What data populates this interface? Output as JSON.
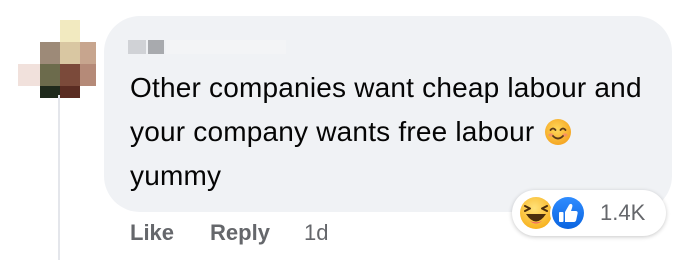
{
  "comment": {
    "text_part1": "Other companies want cheap labour and your company wants free labour",
    "text_part2": "yummy",
    "inline_emoji": "smiling-face-with-smiling-eyes-icon"
  },
  "reactions": {
    "count": "1.4K",
    "icons": [
      "laughing-face-icon",
      "like-thumb-icon"
    ]
  },
  "actions": {
    "like_label": "Like",
    "reply_label": "Reply",
    "timestamp": "1d"
  },
  "colors": {
    "bubble": "#f0f2f5",
    "meta_text": "#65676b",
    "body_text": "#050505",
    "like_blue": "#1877f2",
    "emoji_yellow": "#fbc93d"
  }
}
